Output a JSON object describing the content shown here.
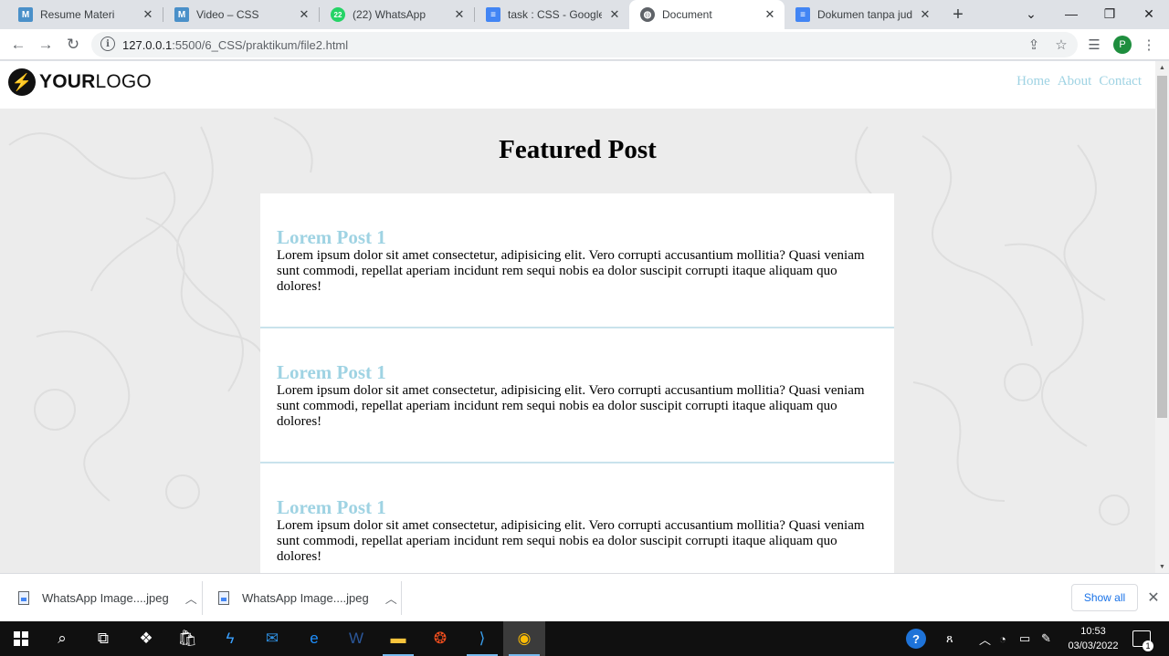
{
  "browser": {
    "tabs": [
      {
        "title": "Resume Materi",
        "favicon": "M",
        "icon": "m-icon",
        "active": false
      },
      {
        "title": "Video – CSS",
        "favicon": "M",
        "icon": "m-icon",
        "active": false
      },
      {
        "title": "(22) WhatsApp",
        "favicon": "22",
        "icon": "whatsapp-icon",
        "active": false
      },
      {
        "title": "task : CSS - Google Do",
        "favicon": "",
        "icon": "google-docs-icon",
        "active": false
      },
      {
        "title": "Document",
        "favicon": "",
        "icon": "globe-icon",
        "active": true
      },
      {
        "title": "Dokumen tanpa judul",
        "favicon": "",
        "icon": "google-docs-icon",
        "active": false
      }
    ],
    "address": {
      "host": "127.0.0.1",
      "path": ":5500/6_CSS/praktikum/file2.html"
    },
    "profile_initial": "P"
  },
  "page": {
    "logo": {
      "bold": "YOUR",
      "light": "LOGO"
    },
    "nav": [
      "Home",
      "About",
      "Contact"
    ],
    "heading": "Featured Post",
    "posts": [
      {
        "title": "Lorem Post 1",
        "body": "Lorem ipsum dolor sit amet consectetur, adipisicing elit. Vero corrupti accusantium mollitia? Quasi veniam sunt commodi, repellat aperiam incidunt rem sequi nobis ea dolor suscipit corrupti itaque aliquam quo dolores!"
      },
      {
        "title": "Lorem Post 1",
        "body": "Lorem ipsum dolor sit amet consectetur, adipisicing elit. Vero corrupti accusantium mollitia? Quasi veniam sunt commodi, repellat aperiam incidunt rem sequi nobis ea dolor suscipit corrupti itaque aliquam quo dolores!"
      },
      {
        "title": "Lorem Post 1",
        "body": "Lorem ipsum dolor sit amet consectetur, adipisicing elit. Vero corrupti accusantium mollitia? Quasi veniam sunt commodi, repellat aperiam incidunt rem sequi nobis ea dolor suscipit corrupti itaque aliquam quo dolores!"
      }
    ],
    "colors": {
      "accent": "#9fd3e3",
      "background": "#ececec"
    }
  },
  "downloads": {
    "items": [
      {
        "name": "WhatsApp Image....jpeg"
      },
      {
        "name": "WhatsApp Image....jpeg"
      }
    ],
    "show_all": "Show all"
  },
  "taskbar": {
    "time": "10:53",
    "date": "03/03/2022",
    "notification_count": "1"
  }
}
